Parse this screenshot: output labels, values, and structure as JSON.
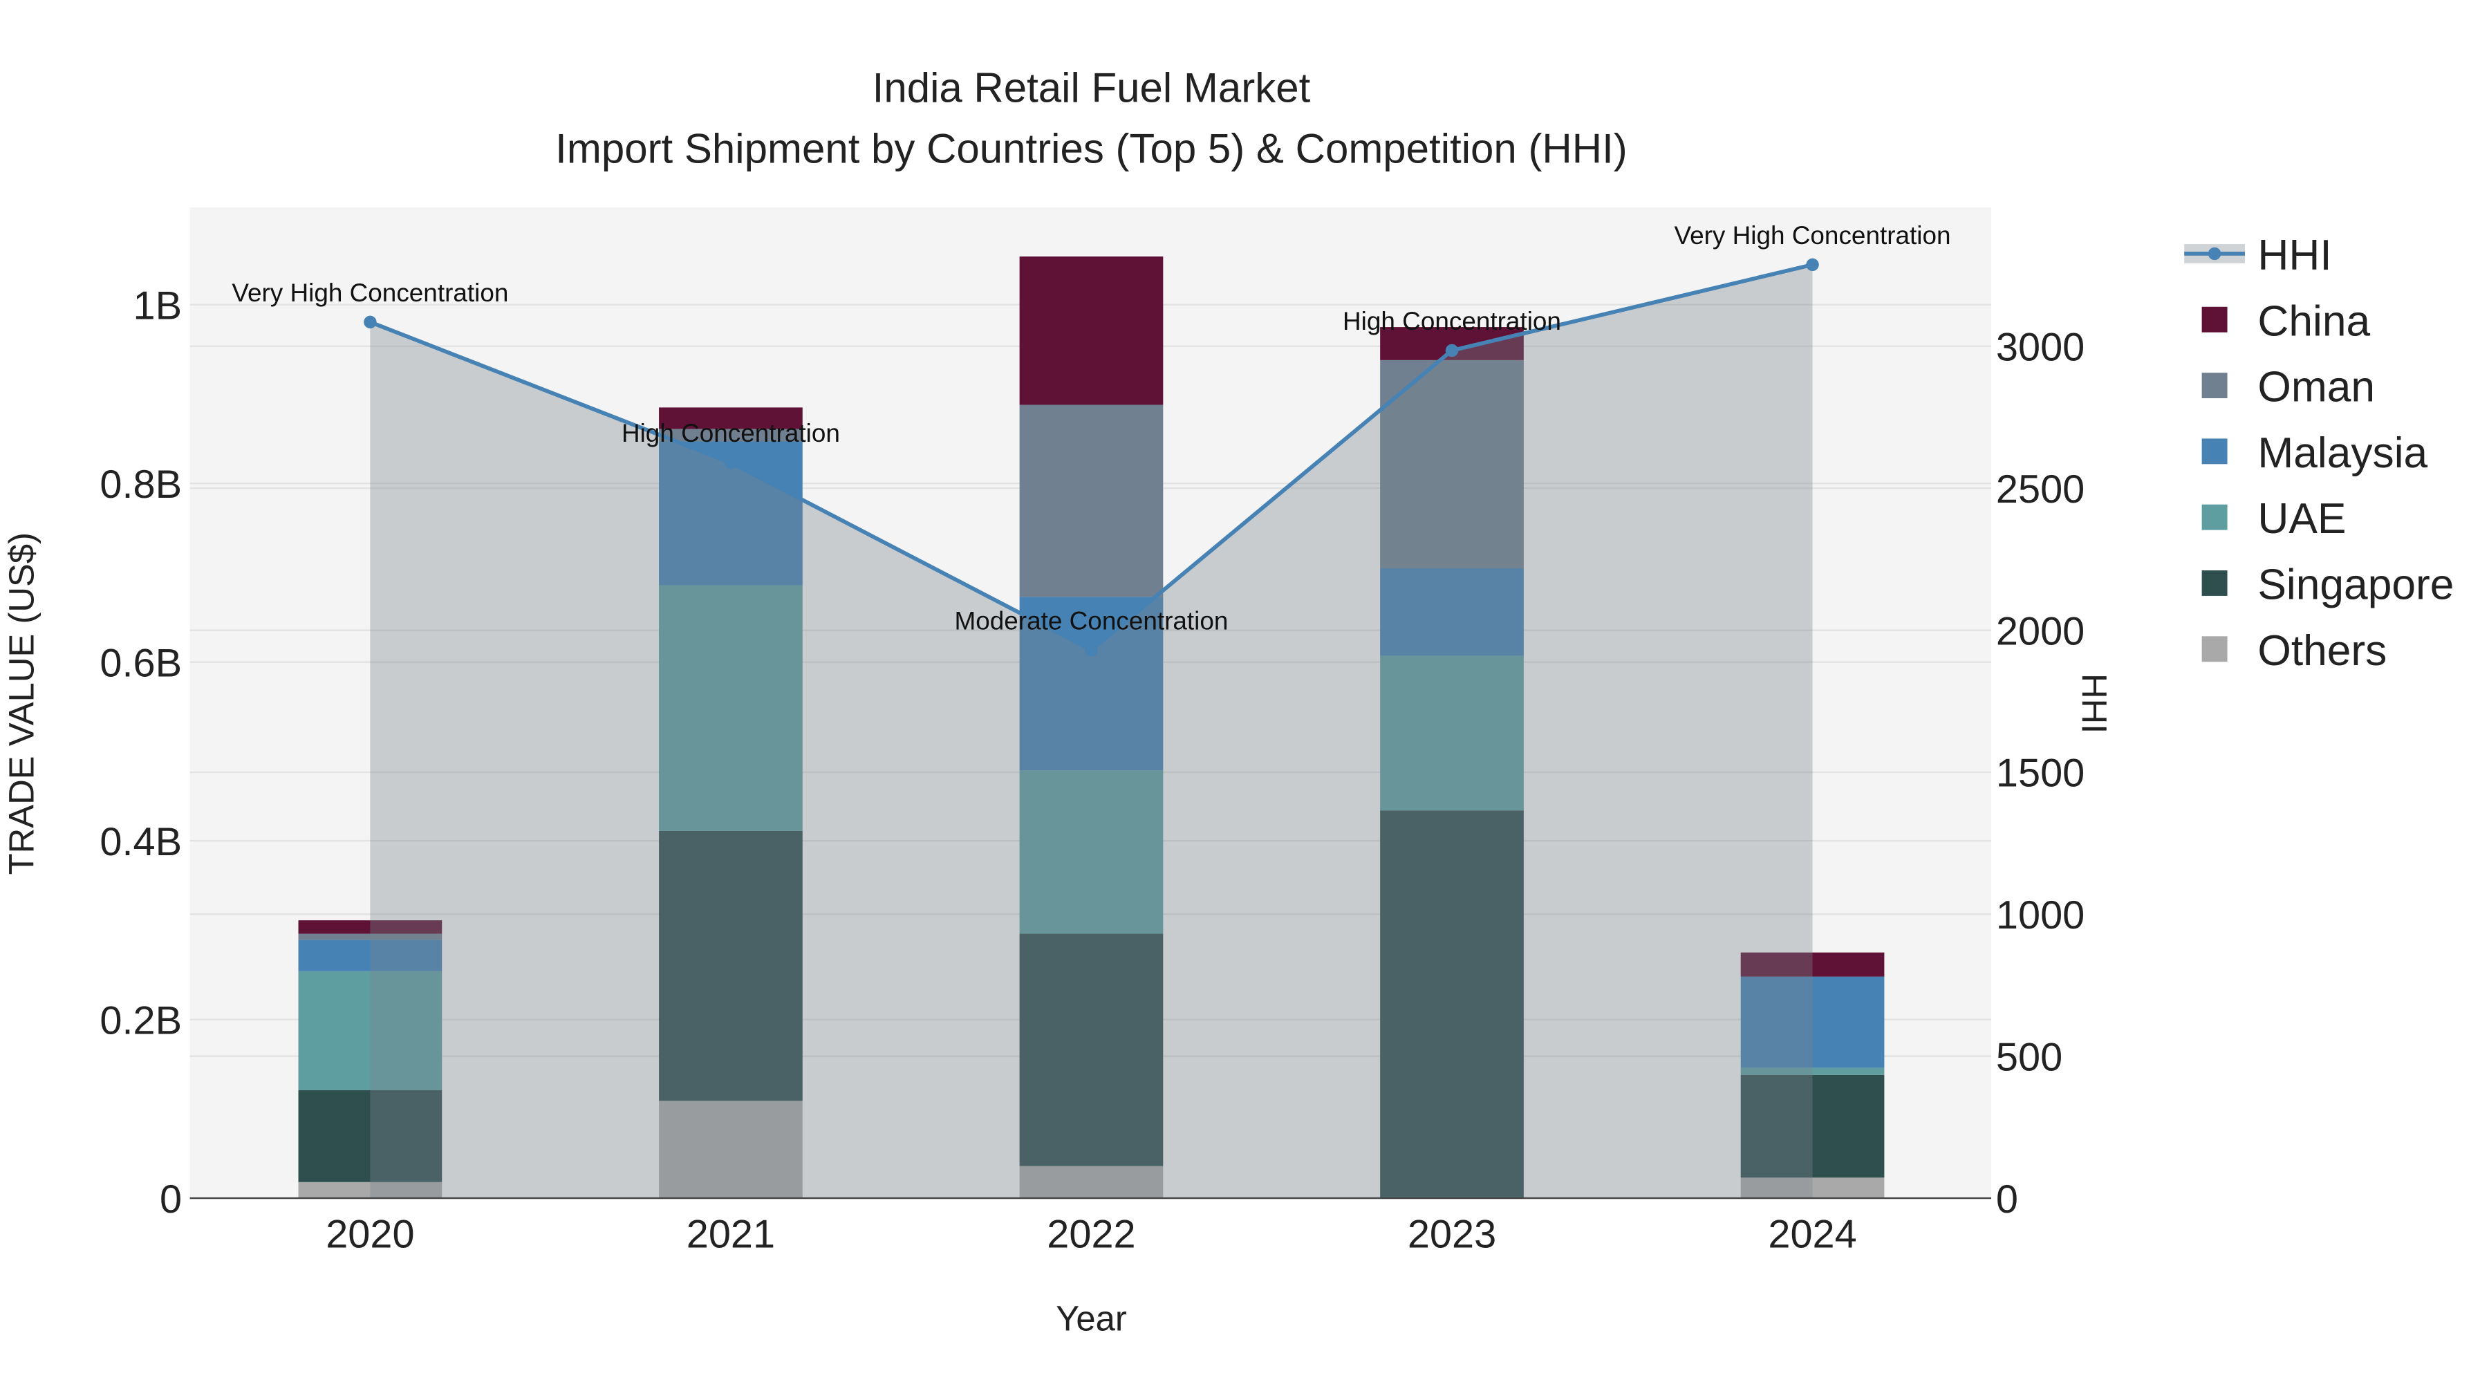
{
  "chart_data": {
    "type": "bar",
    "title": "India Retail Fuel Market",
    "subtitle": "Import Shipment by Countries (Top 5) & Competition (HHI)",
    "xlabel": "Year",
    "ylabel": "TRADE VALUE (US$)",
    "y2label": "HHI",
    "categories": [
      "2020",
      "2021",
      "2022",
      "2023",
      "2024"
    ],
    "ylim": [
      0,
      1.1
    ],
    "y_ticks": [
      0,
      0.2,
      0.4,
      0.6,
      0.8,
      1.0
    ],
    "y_tick_labels": [
      "0",
      "0.2B",
      "0.4B",
      "0.6B",
      "0.8B",
      "1B"
    ],
    "y2lim": [
      0,
      3490
    ],
    "y2_ticks": [
      0,
      500,
      1000,
      1500,
      2000,
      2500,
      3000
    ],
    "y2_tick_labels": [
      "0",
      "500",
      "1000",
      "1500",
      "2000",
      "2500",
      "3000"
    ],
    "units": "billion US$",
    "stacked": true,
    "series": [
      {
        "name": "Others",
        "color": "#a9a9a9",
        "values": [
          0.018,
          0.109,
          0.036,
          0.0,
          0.023
        ]
      },
      {
        "name": "Singapore",
        "color": "#2f4f4f",
        "values": [
          0.103,
          0.302,
          0.26,
          0.434,
          0.115
        ]
      },
      {
        "name": "UAE",
        "color": "#5f9ea0",
        "values": [
          0.133,
          0.275,
          0.183,
          0.173,
          0.008
        ]
      },
      {
        "name": "Malaysia",
        "color": "#4682b4",
        "values": [
          0.035,
          0.161,
          0.194,
          0.098,
          0.102
        ]
      },
      {
        "name": "Oman",
        "color": "#708090",
        "values": [
          0.007,
          0.014,
          0.215,
          0.233,
          0.0
        ]
      },
      {
        "name": "China",
        "color": "#5f1235",
        "values": [
          0.015,
          0.024,
          0.166,
          0.037,
          0.027
        ]
      }
    ],
    "line": {
      "name": "HHI",
      "color": "#4682b4",
      "values": [
        3085,
        2590,
        1930,
        2985,
        3287
      ],
      "annotations": [
        "Very High Concentration",
        "High Concentration",
        "Moderate Concentration",
        "High Concentration",
        "Very High Concentration"
      ]
    },
    "legend": {
      "placement": "right",
      "order": [
        "HHI",
        "China",
        "Oman",
        "Malaysia",
        "UAE",
        "Singapore",
        "Others"
      ]
    },
    "grid": true
  }
}
